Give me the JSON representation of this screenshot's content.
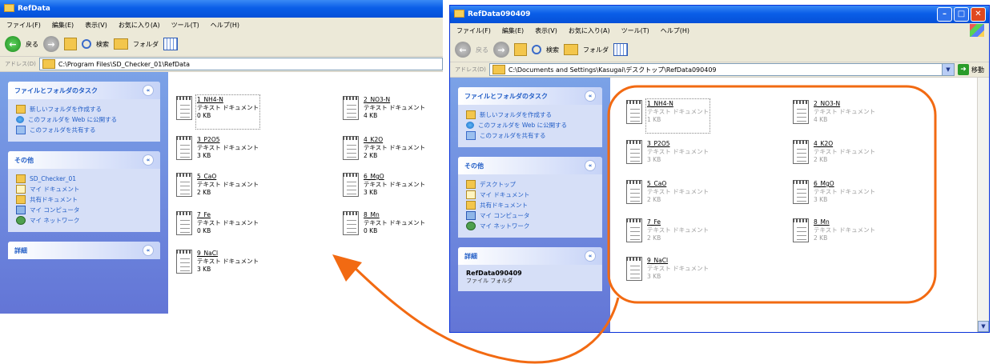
{
  "left_window": {
    "title": "RefData",
    "menu": [
      "ファイル(F)",
      "編集(E)",
      "表示(V)",
      "お気に入り(A)",
      "ツール(T)",
      "ヘルプ(H)"
    ],
    "toolbar": {
      "back": "戻る",
      "search": "検索",
      "folders": "フォルダ"
    },
    "address_label": "アドレス(D)",
    "address": "C:\\Program Files\\SD_Checker_01\\RefData",
    "tasks_header": "ファイルとフォルダのタスク",
    "tasks": [
      "新しいフォルダを作成する",
      "このフォルダを Web に公開する",
      "このフォルダを共有する"
    ],
    "places_header": "その他",
    "places": [
      "SD_Checker_01",
      "マイ ドキュメント",
      "共有ドキュメント",
      "マイ コンピュータ",
      "マイ ネットワーク"
    ],
    "details_header": "詳細",
    "files": [
      {
        "name": "1_NH4-N",
        "type": "テキスト ドキュメント",
        "size": "0 KB"
      },
      {
        "name": "2_NO3-N",
        "type": "テキスト ドキュメント",
        "size": "4 KB"
      },
      {
        "name": "3_P2O5",
        "type": "テキスト ドキュメント",
        "size": "3 KB"
      },
      {
        "name": "4_K2O",
        "type": "テキスト ドキュメント",
        "size": "2 KB"
      },
      {
        "name": "5_CaO",
        "type": "テキスト ドキュメント",
        "size": "2 KB"
      },
      {
        "name": "6_MgO",
        "type": "テキスト ドキュメント",
        "size": "3 KB"
      },
      {
        "name": "7_Fe",
        "type": "テキスト ドキュメント",
        "size": "0 KB"
      },
      {
        "name": "8_Mn",
        "type": "テキスト ドキュメント",
        "size": "0 KB"
      },
      {
        "name": "9_NaCl",
        "type": "テキスト ドキュメント",
        "size": "3 KB"
      }
    ]
  },
  "right_window": {
    "title": "RefData090409",
    "menu": [
      "ファイル(F)",
      "編集(E)",
      "表示(V)",
      "お気に入り(A)",
      "ツール(T)",
      "ヘルプ(H)"
    ],
    "toolbar": {
      "back": "戻る",
      "search": "検索",
      "folders": "フォルダ"
    },
    "address_label": "アドレス(D)",
    "address": "C:\\Documents and Settings\\Kasugai\\デスクトップ\\RefData090409",
    "go_label": "移動",
    "tasks_header": "ファイルとフォルダのタスク",
    "tasks": [
      "新しいフォルダを作成する",
      "このフォルダを Web に公開する",
      "このフォルダを共有する"
    ],
    "places_header": "その他",
    "places": [
      "デスクトップ",
      "マイ ドキュメント",
      "共有ドキュメント",
      "マイ コンピュータ",
      "マイ ネットワーク"
    ],
    "details_header": "詳細",
    "details_title": "RefData090409",
    "details_sub": "ファイル フォルダ",
    "files": [
      {
        "name": "1_NH4-N",
        "type": "テキスト ドキュメント",
        "size": "1 KB"
      },
      {
        "name": "2_NO3-N",
        "type": "テキスト ドキュメント",
        "size": "4 KB"
      },
      {
        "name": "3_P2O5",
        "type": "テキスト ドキュメント",
        "size": "3 KB"
      },
      {
        "name": "4_K2O",
        "type": "テキスト ドキュメント",
        "size": "2 KB"
      },
      {
        "name": "5_CaO",
        "type": "テキスト ドキュメント",
        "size": "2 KB"
      },
      {
        "name": "6_MgO",
        "type": "テキスト ドキュメント",
        "size": "3 KB"
      },
      {
        "name": "7_Fe",
        "type": "テキスト ドキュメント",
        "size": "2 KB"
      },
      {
        "name": "8_Mn",
        "type": "テキスト ドキュメント",
        "size": "2 KB"
      },
      {
        "name": "9_NaCl",
        "type": "テキスト ドキュメント",
        "size": "3 KB"
      }
    ]
  },
  "annotation": {
    "color": "#f26a12"
  }
}
